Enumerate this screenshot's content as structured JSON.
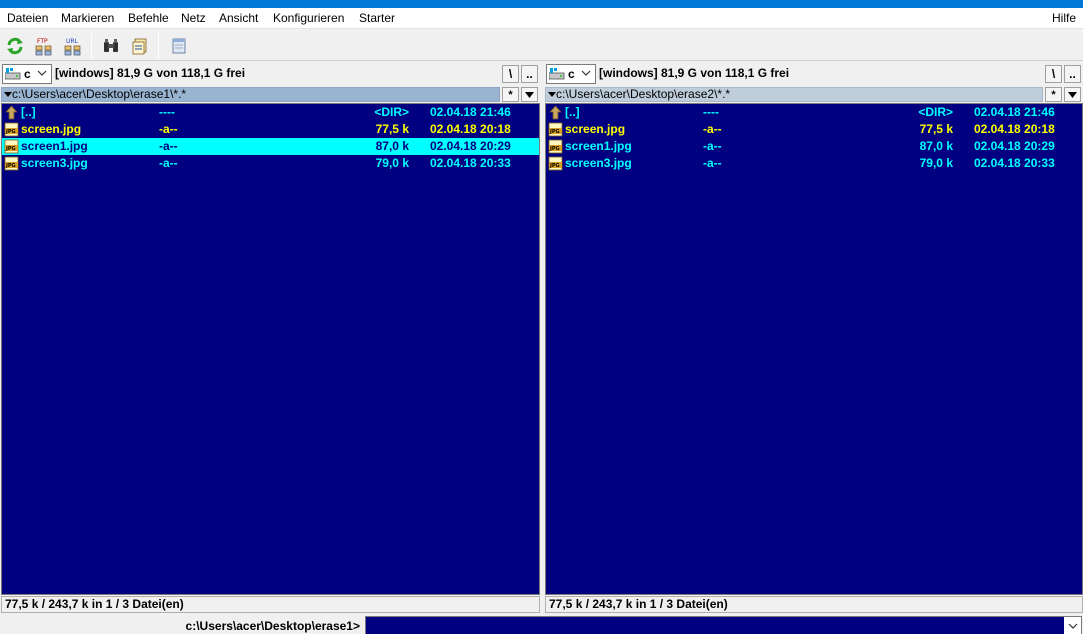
{
  "menu": {
    "items": [
      "Dateien",
      "Markieren",
      "Befehle",
      "Netz",
      "Ansicht",
      "Konfigurieren",
      "Starter"
    ],
    "help": "Hilfe"
  },
  "toolbar": {
    "buttons": [
      {
        "icon": "refresh-icon"
      },
      {
        "icon": "ftp-connect-icon",
        "label": "FTP"
      },
      {
        "icon": "url-connect-icon",
        "label": "URL"
      },
      {
        "icon": "binoculars-icon"
      },
      {
        "icon": "multi-rename-icon"
      },
      {
        "icon": "notepad-icon"
      }
    ]
  },
  "colors": {
    "list_bg": "#000080",
    "dir_text": "#00ffff",
    "file_text": "#ffff00",
    "selected_bg": "#00ffff",
    "path_active_bg": "#99b4d1",
    "title_blue": "#0078d7"
  },
  "left": {
    "drive": {
      "letter": "c",
      "info": "[windows]  81,9 G von 118,1 G frei"
    },
    "root_btn": "\\",
    "parent_btn": "..",
    "path": "c:\\Users\\acer\\Desktop\\erase1\\*.*",
    "path_star": "*",
    "rows": [
      {
        "name": "[..]",
        "attr": "----",
        "size": "<DIR>",
        "date": "02.04.18 21:46",
        "type": "dir"
      },
      {
        "name": "screen.jpg",
        "attr": "-a--",
        "size": "77,5 k",
        "date": "02.04.18 20:18",
        "type": "marked"
      },
      {
        "name": "screen1.jpg",
        "attr": "-a--",
        "size": "87,0 k",
        "date": "02.04.18 20:29",
        "type": "selected"
      },
      {
        "name": "screen3.jpg",
        "attr": "-a--",
        "size": "79,0 k",
        "date": "02.04.18 20:33",
        "type": "file"
      }
    ],
    "status": "77,5 k / 243,7 k in 1 / 3 Datei(en)"
  },
  "right": {
    "drive": {
      "letter": "c",
      "info": "[windows]  81,9 G von 118,1 G frei"
    },
    "root_btn": "\\",
    "parent_btn": "..",
    "path": "c:\\Users\\acer\\Desktop\\erase2\\*.*",
    "path_star": "*",
    "rows": [
      {
        "name": "[..]",
        "attr": "----",
        "size": "<DIR>",
        "date": "02.04.18 21:46",
        "type": "dir"
      },
      {
        "name": "screen.jpg",
        "attr": "-a--",
        "size": "77,5 k",
        "date": "02.04.18 20:18",
        "type": "marked"
      },
      {
        "name": "screen1.jpg",
        "attr": "-a--",
        "size": "87,0 k",
        "date": "02.04.18 20:29",
        "type": "file"
      },
      {
        "name": "screen3.jpg",
        "attr": "-a--",
        "size": "79,0 k",
        "date": "02.04.18 20:33",
        "type": "file"
      }
    ],
    "status": "77,5 k / 243,7 k in 1 / 3 Datei(en)"
  },
  "command": {
    "prompt": "c:\\Users\\acer\\Desktop\\erase1>",
    "value": ""
  }
}
